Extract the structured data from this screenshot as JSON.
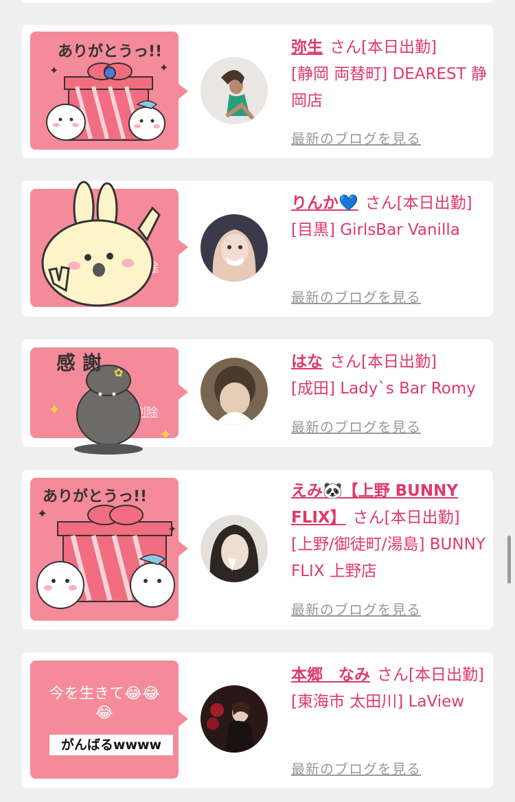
{
  "items": [
    {
      "name": "弥生",
      "san": "さん[本日出勤]",
      "location": "[静岡 両替町] DEAREST 静岡店",
      "blog_link": "最新のブログを見る",
      "sticker": "ありがとうっ!!"
    },
    {
      "name": "りんか💙",
      "san": "さん[本日出勤]",
      "location": "[目黒] GirlsBar Vanilla",
      "blog_link": "最新のブログを見る",
      "hidden_btn": "除"
    },
    {
      "name": "はな",
      "san": "さん[本日出勤]",
      "location": "[成田] Lady`s Bar Romy",
      "blog_link": "最新のブログを見る",
      "sticker": "感 謝",
      "hidden_btn": "削除"
    },
    {
      "name": "えみ🐼【上野 BUNNY FLIX】",
      "san": "さん[本日出勤]",
      "location": "[上野/御徒町/湯島] BUNNY FLIX 上野店",
      "blog_link": "最新のブログを見る",
      "sticker": "ありがとうっ!!"
    },
    {
      "name": "本郷　なみ",
      "san": "さん[本日出勤]",
      "location": "[東海市 太田川] LaView",
      "blog_link": "最新のブログを見る",
      "message_line1": "今を生きて😂😂",
      "message_line2": "😂",
      "message_line3": "がんばるwwww"
    }
  ]
}
